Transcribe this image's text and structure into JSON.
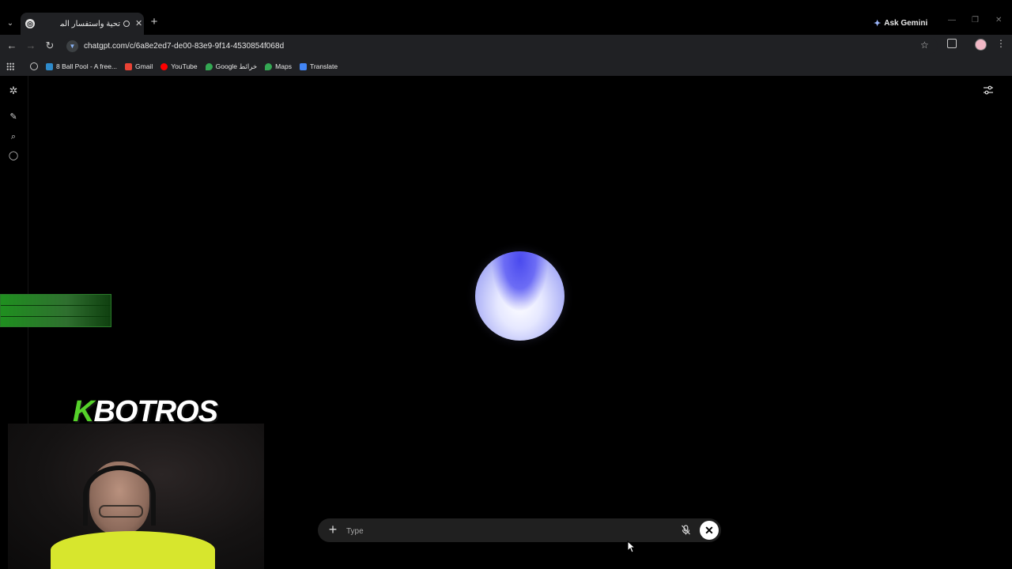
{
  "browser": {
    "tab_title": "تحية واستفسار الملابس",
    "url": "chatgpt.com/c/6a8e2ed7-de00-83e9-9f14-4530854f068d",
    "ask_gemini": "Ask Gemini",
    "bookmarks": [
      {
        "label": "8 Ball Pool - A free...",
        "icon": "pool-icon",
        "color": "#2e8bcc"
      },
      {
        "label": "Gmail",
        "icon": "gmail-icon",
        "color": "#ea4335"
      },
      {
        "label": "YouTube",
        "icon": "youtube-icon",
        "color": "#ff0000"
      },
      {
        "label": "Google خرائط",
        "icon": "maps-icon",
        "color": "#34a853"
      },
      {
        "label": "Maps",
        "icon": "maps-icon",
        "color": "#34a853"
      },
      {
        "label": "Translate",
        "icon": "translate-icon",
        "color": "#4285f4"
      }
    ]
  },
  "composer": {
    "placeholder": "Type"
  },
  "overlay": {
    "logo_k": "K",
    "logo_rest": "BOTROS"
  },
  "colors": {
    "orb_top": "#4a4aee",
    "orb_center": "#ffffff",
    "overlay_green": "#1f8f1f",
    "logo_green": "#55d12a",
    "shirt_yellow": "#d7e62d"
  }
}
